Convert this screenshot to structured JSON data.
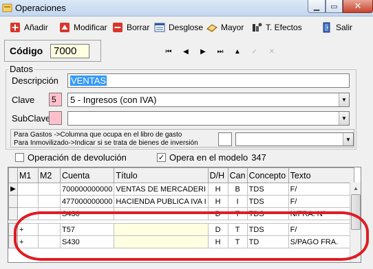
{
  "window": {
    "title": "Operaciones",
    "close_glyph": "✕",
    "min_glyph": "▁",
    "max_glyph": "▭"
  },
  "toolbar": {
    "add_label": "Añadir",
    "modify_label": "Modificar",
    "delete_label": "Borrar",
    "breakdown_label": "Desglose",
    "ledger_label": "Mayor",
    "effects_label": "T. Efectos",
    "exit_label": "Salir"
  },
  "codigo": {
    "label": "Código",
    "value": "7000"
  },
  "datos": {
    "legend": "Datos",
    "descripcion_label": "Descripción",
    "descripcion_value": "VENTAS",
    "clave_label": "Clave",
    "clave_code": "5",
    "clave_value": "5 - Ingresos (con IVA)",
    "subclave_label": "SubClave",
    "subclave_code": "",
    "subclave_value": "",
    "note_line1": "Para Gastos ->Columna que ocupa en el libro de gasto",
    "note_line2": "Para Inmovilizado->Indicar si se trata de bienes de inversión",
    "note_box_value": "",
    "note_select_value": ""
  },
  "options": {
    "devolucion_label": "Operación de devolución",
    "devolucion_checked": false,
    "modelo_label": "Opera en el modelo",
    "modelo_checked": true,
    "modelo_number": "347"
  },
  "grid": {
    "columns": [
      "M1",
      "M2",
      "Cuenta",
      "Título",
      "D/H",
      "Can",
      "Concepto",
      "Texto"
    ],
    "rows": [
      {
        "ind": "▶",
        "m1": "",
        "m2": "",
        "cuenta": "700000000000",
        "titulo": "VENTAS DE MERCADERI",
        "dh": "H",
        "can": "B",
        "concepto": "TDS",
        "texto": "F/"
      },
      {
        "ind": "",
        "m1": "",
        "m2": "",
        "cuenta": "477000000000",
        "titulo": "HACIENDA PUBLICA IVA I",
        "dh": "H",
        "can": "I",
        "concepto": "TDS",
        "texto": "F/"
      },
      {
        "ind": "",
        "m1": "",
        "m2": "",
        "cuenta": "S430",
        "titulo": "",
        "dh": "D",
        "can": "T",
        "concepto": "TDS",
        "texto": "N/FRA. Nº"
      },
      {
        "ind": "",
        "m1": "+",
        "m2": "",
        "cuenta": "T57",
        "titulo": "",
        "dh": "D",
        "can": "T",
        "concepto": "TDS",
        "texto": "F/"
      },
      {
        "ind": "",
        "m1": "+",
        "m2": "",
        "cuenta": "S430",
        "titulo": "",
        "dh": "H",
        "can": "T",
        "concepto": "TD",
        "texto": "S/PAGO FRA."
      }
    ]
  },
  "colors": {
    "highlight_oval": "#e11b22",
    "selection": "#3399ff",
    "input_yellow": "#ffffe1",
    "key_pink": "#ffc0cb"
  }
}
